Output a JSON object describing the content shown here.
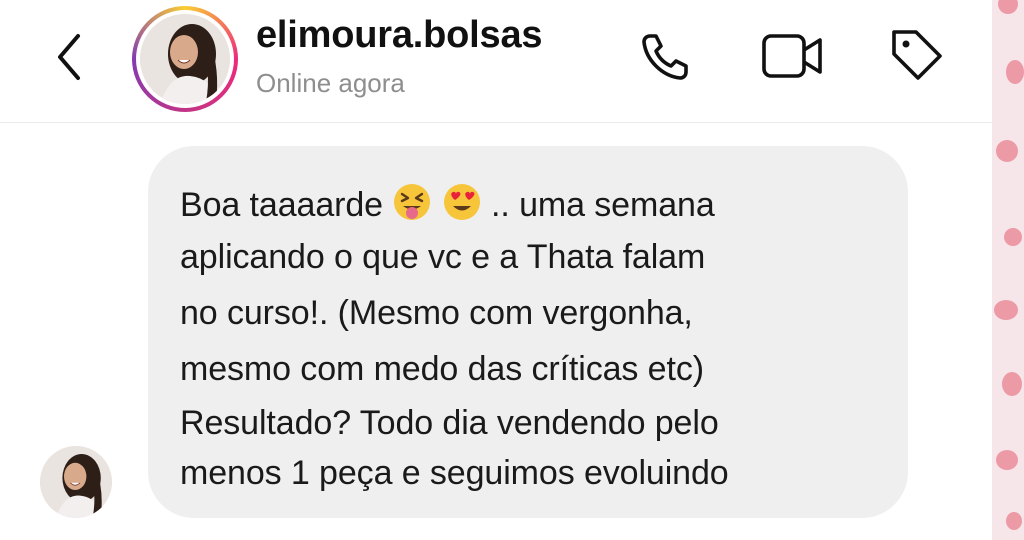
{
  "header": {
    "username": "elimoura.bolsas",
    "status": "Online agora",
    "icons": [
      "back-chevron-icon",
      "phone-icon",
      "video-camera-icon",
      "tag-icon"
    ]
  },
  "message": {
    "line1_start": "Boa taaaarde",
    "emoji1": "squinting-tongue-face",
    "emoji2": "heart-eyes-face",
    "line1_end": ".. uma semana",
    "line2": "aplicando o que vc e a Thata falam",
    "line3": "no curso!. (Mesmo com vergonha,",
    "line4": "mesmo com medo das críticas etc)",
    "line5": "Resultado? Todo dia vendendo pelo",
    "line6": "menos 1 peça e seguimos evoluindo"
  },
  "colors": {
    "bubble": "#efefef",
    "text": "#1a1a1a",
    "status": "#8e8e8e",
    "decor_pink": "#ec9aa6"
  }
}
